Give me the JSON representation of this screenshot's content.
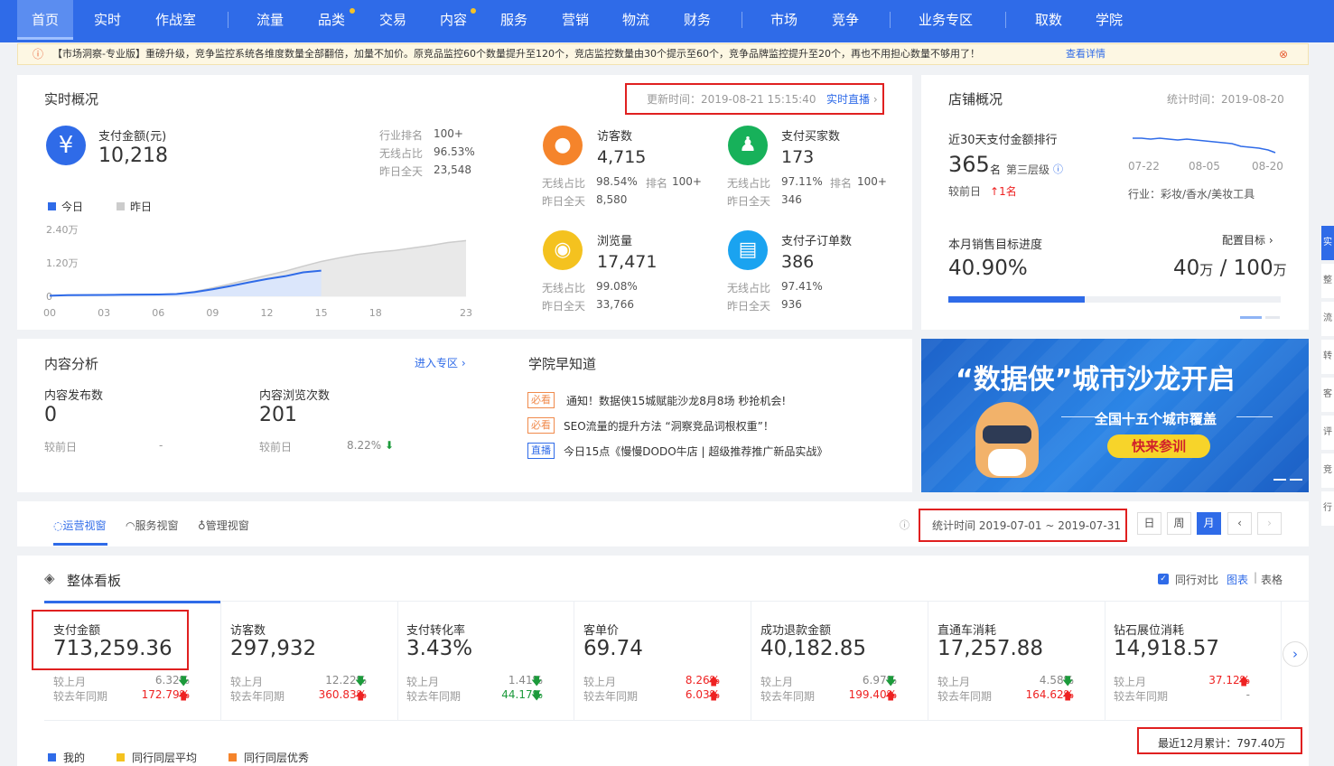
{
  "nav": {
    "items": [
      "首页",
      "实时",
      "作战室",
      "流量",
      "品类",
      "交易",
      "内容",
      "服务",
      "营销",
      "物流",
      "财务",
      "市场",
      "竞争",
      "业务专区",
      "取数",
      "学院"
    ],
    "active": "首页",
    "brand_color": "#2f6be8"
  },
  "notice": {
    "icon": "info-icon",
    "text": "【市场洞察-专业版】重磅升级，竞争监控系统各维度数量全部翻倍，加量不加价。原竞品监控60个数量提升至120个，竞店监控数量由30个提示至60个，竞争品牌监控提升至20个，再也不用担心数量不够用了！",
    "link": "查看详情"
  },
  "realtime": {
    "title": "实时概况",
    "update_time": "更新时间：2019-08-21 15:15:40",
    "live_link": "实时直播",
    "pay": {
      "label": "支付金额(元)",
      "value": "10,218",
      "rank_label": "行业排名",
      "rank": "100+",
      "wireless_label": "无线占比",
      "wireless": "96.53%",
      "yday_label": "昨日全天",
      "yday": "23,548"
    },
    "legend_today": "今日",
    "legend_yday": "昨日",
    "visitors": {
      "label": "访客数",
      "value": "4,715",
      "wl": "无线占比",
      "w": "98.54%",
      "rl": "排名",
      "r": "100+",
      "yl": "昨日全天",
      "y": "8,580"
    },
    "buyers": {
      "label": "支付买家数",
      "value": "173",
      "wl": "无线占比",
      "w": "97.11%",
      "rl": "排名",
      "r": "100+",
      "yl": "昨日全天",
      "y": "346"
    },
    "pv": {
      "label": "浏览量",
      "value": "17,471",
      "wl": "无线占比",
      "w": "99.08%",
      "yl": "昨日全天",
      "y": "33,766"
    },
    "suborders": {
      "label": "支付子订单数",
      "value": "386",
      "wl": "无线占比",
      "w": "97.41%",
      "yl": "昨日全天",
      "y": "936"
    }
  },
  "chart_data": {
    "type": "area",
    "x_ticks": [
      "00",
      "03",
      "06",
      "09",
      "12",
      "15",
      "18",
      "23"
    ],
    "y_ticks": [
      "2.40万",
      "1.20万",
      "0"
    ],
    "ylim": [
      0,
      24000
    ],
    "series": [
      {
        "name": "今日",
        "x": [
          0,
          1,
          2,
          3,
          4,
          5,
          6,
          7,
          8,
          9,
          10,
          11,
          12,
          13,
          14,
          15
        ],
        "values": [
          200,
          400,
          450,
          500,
          550,
          600,
          650,
          800,
          1500,
          2500,
          3700,
          5000,
          6200,
          7200,
          8600,
          9200
        ]
      },
      {
        "name": "昨日",
        "x": [
          0,
          1,
          2,
          3,
          4,
          5,
          6,
          7,
          8,
          9,
          10,
          11,
          12,
          13,
          14,
          15,
          16,
          17,
          18,
          19,
          20,
          21,
          22,
          23
        ],
        "values": [
          300,
          450,
          500,
          550,
          600,
          650,
          700,
          900,
          1700,
          3000,
          4500,
          6000,
          7500,
          9000,
          10800,
          12500,
          13800,
          15000,
          15800,
          16400,
          17300,
          18200,
          19300,
          20000
        ]
      }
    ]
  },
  "store": {
    "title": "店铺概况",
    "stat_time": "统计时间：2019-08-20",
    "rank_title": "近30天支付金额排行",
    "rank_value": "365",
    "rank_unit": "名",
    "tier": "第三层级",
    "compare_label": "较前日",
    "compare_value": "1名",
    "spark_x": [
      "07-22",
      "08-05",
      "08-20"
    ],
    "industry": "行业：彩妆/香水/美妆工具",
    "target_title": "本月销售目标进度",
    "target_link": "配置目标",
    "progress": "40.90%",
    "progress_fraction": 0.409,
    "sales_now": "40",
    "sales_target": "100",
    "unit": "万",
    "slash": "/"
  },
  "content": {
    "title": "内容分析",
    "link": "进入专区",
    "publish_label": "内容发布数",
    "publish_value": "0",
    "views_label": "内容浏览次数",
    "views_value": "201",
    "cmp_label": "较前日",
    "cmp_publish": "-",
    "cmp_views": "8.22%"
  },
  "academy": {
    "title": "学院早知道",
    "items": [
      {
        "tag": "必看",
        "text": "通知！数据侠15城赋能沙龙8月8场 秒抢机会!"
      },
      {
        "tag": "必看",
        "text": "SEO流量的提升方法 “洞察竞品词根权重”！"
      },
      {
        "tag": "直播",
        "text": "今日15点《慢慢DODO牛店 | 超级推荐推广新品实战》"
      }
    ]
  },
  "banner": {
    "title": "“数据侠”城市沙龙开启",
    "subtitle": "全国十五个城市覆盖",
    "button": "快来参训"
  },
  "tabs": {
    "items": [
      "运营视窗",
      "服务视窗",
      "管理视窗"
    ],
    "stat_time": "统计时间 2019-07-01 ~ 2019-07-31",
    "periods": [
      "日",
      "周",
      "月"
    ],
    "active_period": "月"
  },
  "board": {
    "title": "整体看板",
    "peer_compare": "同行对比",
    "view_chart": "图表",
    "divider": "|",
    "view_table": "表格",
    "annual": "最近12月累计：797.40万",
    "legend": [
      "我的",
      "同行同层平均",
      "同行同层优秀"
    ],
    "mom_label": "较上月",
    "yoy_label": "较去年同期",
    "metrics": [
      {
        "name": "支付金额",
        "value": "713,259.36",
        "mom": "6.32%",
        "mom_dir": "down",
        "yoy": "172.79%",
        "yoy_dir": "up"
      },
      {
        "name": "访客数",
        "value": "297,932",
        "mom": "12.22%",
        "mom_dir": "down",
        "yoy": "360.83%",
        "yoy_dir": "up"
      },
      {
        "name": "支付转化率",
        "value": "3.43%",
        "mom": "1.41%",
        "mom_dir": "down",
        "yoy": "44.17%",
        "yoy_dir": "down"
      },
      {
        "name": "客单价",
        "value": "69.74",
        "mom": "8.26%",
        "mom_dir": "up",
        "yoy": "6.03%",
        "yoy_dir": "up"
      },
      {
        "name": "成功退款金额",
        "value": "40,182.85",
        "mom": "6.97%",
        "mom_dir": "down",
        "yoy": "199.40%",
        "yoy_dir": "up"
      },
      {
        "name": "直通车消耗",
        "value": "17,257.88",
        "mom": "4.58%",
        "mom_dir": "down",
        "yoy": "164.62%",
        "yoy_dir": "up"
      },
      {
        "name": "钻石展位消耗",
        "value": "14,918.57",
        "mom": "37.12%",
        "mom_dir": "up",
        "yoy": "-",
        "yoy_dir": "none"
      }
    ]
  },
  "side_tabs": [
    "实",
    "整",
    "流",
    "转",
    "客",
    "评",
    "竞",
    "行"
  ]
}
